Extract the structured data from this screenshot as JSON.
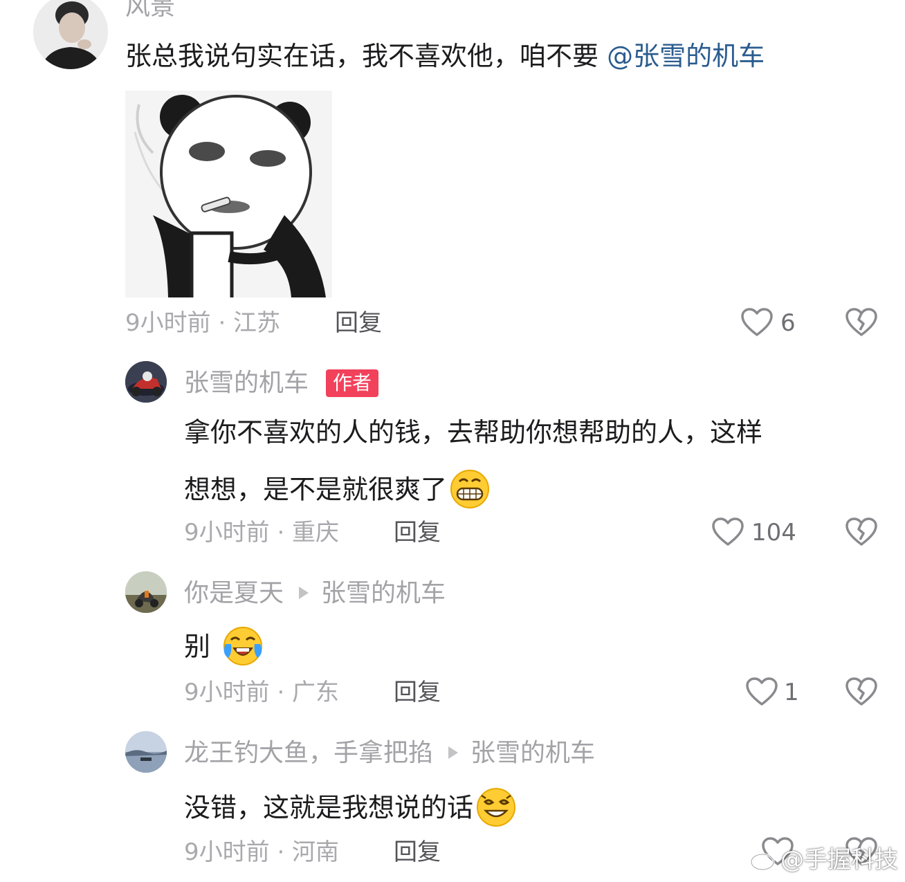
{
  "comments": [
    {
      "username": "风景",
      "text": "张总我说句实在话，我不喜欢他，咱不要 ",
      "mention": "@张雪的机车",
      "time_location": "9小时前 · 江苏",
      "reply_label": "回复",
      "likes": "6"
    },
    {
      "username": "张雪的机车",
      "badge": "作者",
      "text_line1": "拿你不喜欢的人的钱，去帮助你想帮助的人，这样",
      "text_line2": "想想，是不是就很爽了",
      "time_location": "9小时前 · 重庆",
      "reply_label": "回复",
      "likes": "104"
    },
    {
      "username": "你是夏天",
      "reply_to": "张雪的机车",
      "text": "别",
      "time_location": "9小时前 · 广东",
      "reply_label": "回复",
      "likes": "1"
    },
    {
      "username": "龙王钓大鱼，手拿把掐",
      "reply_to": "张雪的机车",
      "text": "没错，这就是我想说的话",
      "time_location": "9小时前 · 河南",
      "reply_label": "回复"
    }
  ],
  "icons": {
    "like": "heart-outline-icon",
    "dislike": "broken-heart-icon",
    "reply_arrow": "play-triangle-icon"
  },
  "colors": {
    "badge": "#f2415b",
    "mention": "#2b5c8f"
  },
  "watermark": "@手握科技"
}
